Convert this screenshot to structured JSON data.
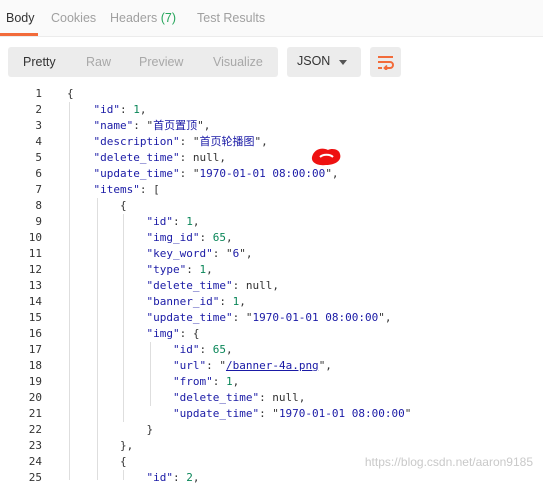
{
  "tabs": [
    {
      "label": "Body"
    },
    {
      "label": "Cookies"
    },
    {
      "label": "Headers",
      "count": "(7)"
    },
    {
      "label": "Test Results"
    }
  ],
  "toolbar": {
    "modes": [
      "Pretty",
      "Raw",
      "Preview",
      "Visualize"
    ],
    "format": "JSON",
    "wrap_icon": "wrap-lines-icon"
  },
  "colors": {
    "accent": "#f26b3a",
    "count": "#26a65b",
    "key": "#1a1aa6",
    "number": "#098658"
  },
  "code_lines": [
    {
      "n": "1",
      "t": "{"
    },
    {
      "n": "2",
      "t": "    \"id\": 1,"
    },
    {
      "n": "3",
      "t": "    \"name\": \"首页置顶\","
    },
    {
      "n": "4",
      "t": "    \"description\": \"首页轮播图\","
    },
    {
      "n": "5",
      "t": "    \"delete_time\": null,"
    },
    {
      "n": "6",
      "t": "    \"update_time\": \"1970-01-01 08:00:00\","
    },
    {
      "n": "7",
      "t": "    \"items\": ["
    },
    {
      "n": "8",
      "t": "        {"
    },
    {
      "n": "9",
      "t": "            \"id\": 1,"
    },
    {
      "n": "10",
      "t": "            \"img_id\": 65,"
    },
    {
      "n": "11",
      "t": "            \"key_word\": \"6\","
    },
    {
      "n": "12",
      "t": "            \"type\": 1,"
    },
    {
      "n": "13",
      "t": "            \"delete_time\": null,"
    },
    {
      "n": "14",
      "t": "            \"banner_id\": 1,"
    },
    {
      "n": "15",
      "t": "            \"update_time\": \"1970-01-01 08:00:00\","
    },
    {
      "n": "16",
      "t": "            \"img\": {"
    },
    {
      "n": "17",
      "t": "                \"id\": 65,"
    },
    {
      "n": "18",
      "t": "                \"url\": \"/banner-4a.png\","
    },
    {
      "n": "19",
      "t": "                \"from\": 1,"
    },
    {
      "n": "20",
      "t": "                \"delete_time\": null,"
    },
    {
      "n": "21",
      "t": "                \"update_time\": \"1970-01-01 08:00:00\""
    },
    {
      "n": "22",
      "t": "            }"
    },
    {
      "n": "23",
      "t": "        },"
    },
    {
      "n": "24",
      "t": "        {"
    },
    {
      "n": "25",
      "t": "            \"id\": 2,"
    }
  ],
  "watermark": "https://blog.csdn.net/aaron9185"
}
